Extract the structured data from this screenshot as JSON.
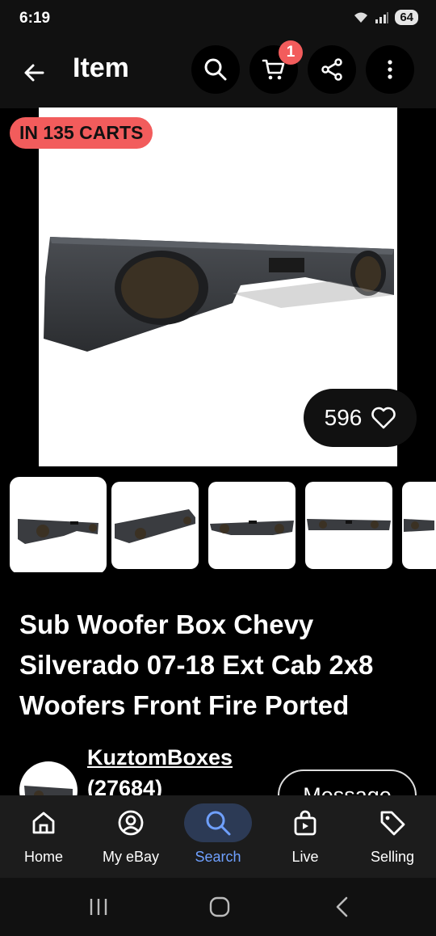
{
  "status": {
    "time": "6:19",
    "battery": "64"
  },
  "header": {
    "title": "Item",
    "cart_count": "1"
  },
  "listing": {
    "carts_badge": "IN 135 CARTS",
    "watchers": "596",
    "title": "Sub Woofer Box Chevy Silverado 07-18 Ext Cab 2x8 Woofers Front Fire Ported"
  },
  "seller": {
    "name": "KuztomBoxes",
    "feedback": "(27684)",
    "message_label": "Message"
  },
  "bottom_nav": [
    {
      "label": "Home",
      "icon": "home-icon"
    },
    {
      "label": "My eBay",
      "icon": "user-circle-icon"
    },
    {
      "label": "Search",
      "icon": "search-icon",
      "active": true
    },
    {
      "label": "Live",
      "icon": "live-bag-icon"
    },
    {
      "label": "Selling",
      "icon": "tag-icon"
    }
  ],
  "colors": {
    "accent_badge": "#f25c5c",
    "active_nav": "#6fa0ff",
    "active_nav_bg": "#2c3a55"
  }
}
